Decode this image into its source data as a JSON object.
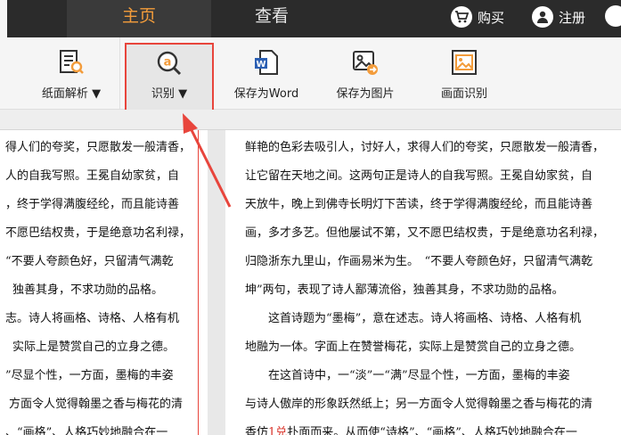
{
  "topbar": {
    "tabs": [
      {
        "label": "主页"
      },
      {
        "label": "查看"
      }
    ],
    "buy_label": "购买",
    "register_label": "注册"
  },
  "toolbar": {
    "parse_label": "纸面解析",
    "recognize_label": "识别",
    "save_word_label": "保存为Word",
    "save_image_label": "保存为图片",
    "screen_recognize_label": "画面识别",
    "word_badge": "W",
    "recognize_badge": "a"
  },
  "left_text": {
    "lines": [
      "得人们的夸奖，只愿散发一般清香，",
      "人的自我写照。王冕自幼家贫，自",
      "，终于学得满腹经纶，而且能诗善",
      "不愿巴结权贵，于是绝意功名利禄，",
      "“不要人夸颜色好，只留清气满乾",
      "独善其身，不求功勋的品格。",
      "志。诗人将画格、诗格、人格有机",
      "实际上是赞赏自己的立身之德。",
      "”尽显个性，一方面，墨梅的丰姿",
      "方面令人觉得翰墨之香与梅花的清",
      "、“画格”、人格巧妙地融合在一"
    ]
  },
  "right_text": {
    "lines": [
      "鲜艳的色彩去吸引人，讨好人，求得人们的夸奖，只愿散发一般清香，",
      "让它留在天地之间。这两句正是诗人的自我写照。王冕自幼家贫，自",
      "天放牛，晚上到佛寺长明灯下苦读，终于学得满腹经纶，而且能诗善",
      "画，多才多艺。但他屡试不第，又不愿巴结权贵，于是绝意功名利禄，",
      "归隐浙东九里山，作画易米为生。　“不要人夸颜色好，只留清气满乾",
      "坤”两句，表现了诗人鄙薄流俗，独善其身，不求功勋的品格。",
      "　　这首诗题为“墨梅”，意在述志。诗人将画格、诗格、人格有机",
      "地融为一体。字面上在赞誉梅花，实际上是赞赏自己的立身之德。",
      "　　在这首诗中，一“淡”一“满”尽显个性，一方面，墨梅的丰姿",
      "与诗人傲岸的形象跃然纸上；另一方面令人觉得翰墨之香与梅花的清",
      "香仿佛扑面而来。从而使“诗格”、“画格”、人格巧妙地融合在一"
    ],
    "last_line_parts": {
      "before": "香仿",
      "red": "1兑",
      "after": "扑面而来。从而使“诗格”、“画格”、人格巧妙地融合在一"
    }
  },
  "colors": {
    "accent": "#f39c3b",
    "highlight": "#e8453c",
    "topbar": "#2b2b2b"
  }
}
